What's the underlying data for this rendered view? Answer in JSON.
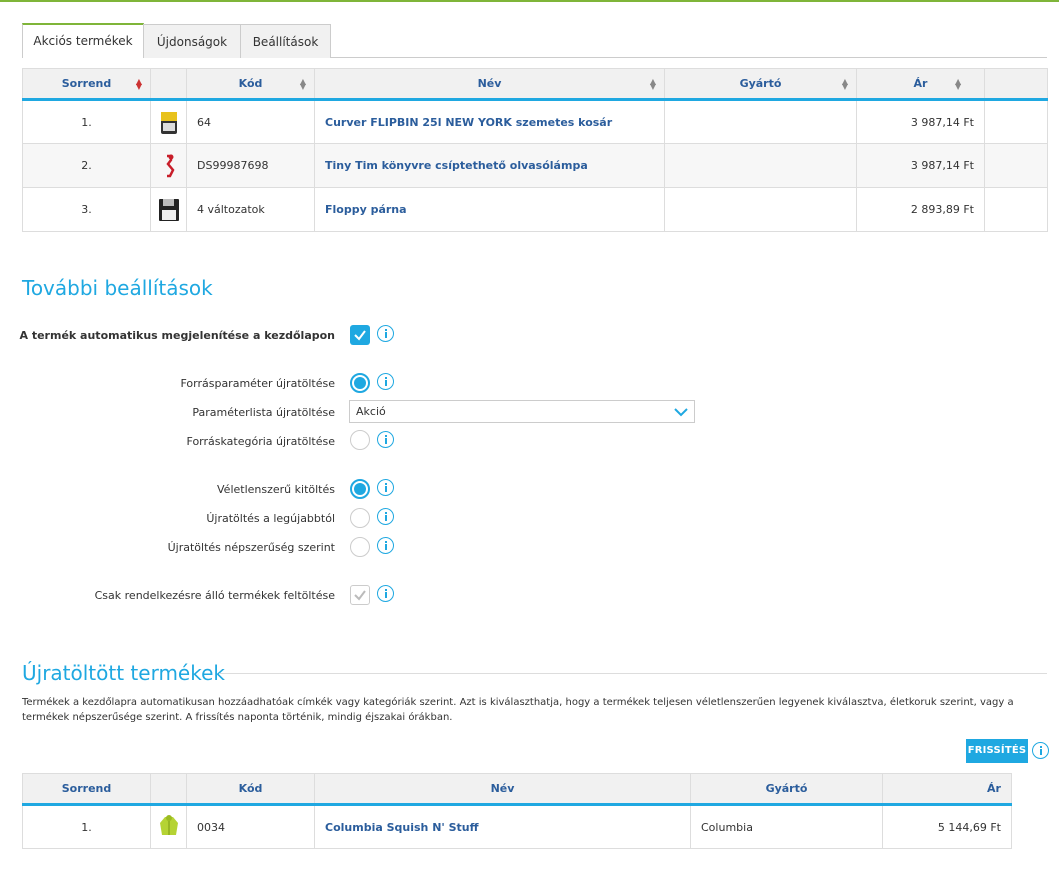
{
  "tabs": [
    {
      "label": "Akciós termékek",
      "active": true
    },
    {
      "label": "Újdonságok",
      "active": false
    },
    {
      "label": "Beállítások",
      "active": false
    }
  ],
  "top_table": {
    "columns": [
      "Sorrend",
      "",
      "Kód",
      "Név",
      "Gyártó",
      "Ár",
      ""
    ],
    "rows": [
      {
        "order": "1.",
        "image": "trash-bin-image",
        "code": "64",
        "name": "Curver FLIPBIN 25l NEW YORK szemetes kosár",
        "brand": "",
        "price": "3 987,14 Ft"
      },
      {
        "order": "2.",
        "image": "reading-lamp-image",
        "code": "DS99987698",
        "name": "Tiny Tim könyvre csíptethető olvasólámpa",
        "brand": "",
        "price": "3 987,14 Ft"
      },
      {
        "order": "3.",
        "image": "floppy-pillow-image",
        "code": "4 változatok",
        "name": "Floppy párna",
        "brand": "",
        "price": "2 893,89 Ft"
      }
    ]
  },
  "settings": {
    "title": "További beállítások",
    "auto_show_label": "A termék automatikus megjelenítése a kezdőlapon",
    "auto_show_checked": true,
    "source_param_label": "Forrásparaméter újratöltése",
    "source_param_selected": true,
    "param_list_label": "Paraméterlista újratöltése",
    "param_list_value": "Akció",
    "source_category_label": "Forráskategória újratöltése",
    "source_category_selected": false,
    "random_fill_label": "Véletlenszerű kitöltés",
    "random_fill_selected": true,
    "newest_label": "Újratöltés a legújabbtól",
    "newest_selected": false,
    "popularity_label": "Újratöltés népszerűség szerint",
    "popularity_selected": false,
    "available_only_label": "Csak rendelkezésre álló termékek feltöltése",
    "available_only_checked": true,
    "available_only_disabled": true
  },
  "reloaded": {
    "title": "Újratöltött termékek",
    "description": "Termékek a kezdőlapra automatikusan hozzáadhatóak címkék vagy kategóriák szerint. Azt is kiválaszthatja, hogy a termékek teljesen véletlenszerűen legyenek kiválasztva, életkoruk szerint, vagy a termékek népszerűsége szerint. A frissítés naponta történik, mindig éjszakai órákban.",
    "refresh_label": "FRISSÍTÉS",
    "columns": [
      "Sorrend",
      "",
      "Kód",
      "Név",
      "Gyártó",
      "Ár"
    ],
    "rows": [
      {
        "order": "1.",
        "image": "jacket-image",
        "code": "0034",
        "name": "Columbia Squish N' Stuff",
        "brand": "Columbia",
        "price": "5 144,69 Ft"
      }
    ]
  },
  "colors": {
    "accent": "#1fa8e1",
    "tab_active": "#7fb539",
    "price": "#2e8b24",
    "link": "#2b5d9c"
  }
}
